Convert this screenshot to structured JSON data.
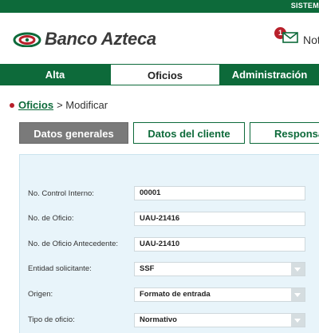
{
  "topbar": {
    "system_label": "SISTEM"
  },
  "brand": {
    "name": "Banco Azteca",
    "colors": {
      "primary": "#0d6a3a",
      "accent": "#b8202b"
    }
  },
  "notifications": {
    "count": "1",
    "label": "Noti",
    "icon": "envelope-icon"
  },
  "nav": {
    "items": [
      {
        "label": "Alta"
      },
      {
        "label": "Oficios"
      },
      {
        "label": "Administración"
      }
    ],
    "active": "Oficios"
  },
  "breadcrumb": {
    "link": "Oficios",
    "rest": "> Modificar"
  },
  "tabs": [
    {
      "label": "Datos generales"
    },
    {
      "label": "Datos del cliente"
    },
    {
      "label": "Responsal"
    }
  ],
  "form": {
    "fields": [
      {
        "label": "No. Control Interno:",
        "value": "00001",
        "type": "text"
      },
      {
        "label": "No. de Oficio:",
        "value": "UAU-21416",
        "type": "text"
      },
      {
        "label": "No. de Oficio Antecedente:",
        "value": "UAU-21410",
        "type": "text"
      },
      {
        "label": "Entidad solicitante:",
        "value": "SSF",
        "type": "select"
      },
      {
        "label": "Origen:",
        "value": "Formato de entrada",
        "type": "select"
      },
      {
        "label": "Tipo de oficio:",
        "value": "Normativo",
        "type": "select"
      }
    ]
  }
}
